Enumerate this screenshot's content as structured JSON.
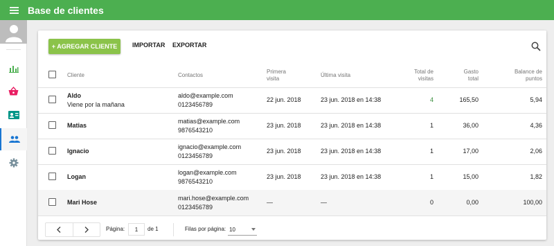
{
  "header": {
    "title": "Base de clientes",
    "menu_icon": "menu-icon"
  },
  "sidebar": {
    "avatar_icon": "user-avatar-icon",
    "items": [
      {
        "icon": "bar-chart-icon",
        "color": "#4caf50"
      },
      {
        "icon": "basket-icon",
        "color": "#e91e63"
      },
      {
        "icon": "contact-card-icon",
        "color": "#009688"
      },
      {
        "icon": "people-icon",
        "color": "#1976d2",
        "active": true
      },
      {
        "icon": "settings-icon",
        "color": "#78909c"
      }
    ]
  },
  "toolbar": {
    "add_label": "+ AGREGAR CLIENTE",
    "import_label": "IMPORTAR",
    "export_label": "EXPORTAR",
    "search_icon": "search-icon"
  },
  "table": {
    "headers": {
      "client": "Cliente",
      "contacts": "Contactos",
      "first_visit_1": "Primera",
      "first_visit_2": "visita",
      "last_visit": "Última visita",
      "total_visits_1": "Total de",
      "total_visits_2": "visitas",
      "spend_1": "Gasto",
      "spend_2": "total",
      "points_1": "Balance de",
      "points_2": "puntos"
    },
    "rows": [
      {
        "name": "Aldo",
        "note": "Viene por la mañana",
        "email": "aldo@example.com",
        "phone": "0123456789",
        "first_visit": "22 jun. 2018",
        "last_visit": "23 jun. 2018 en 14:38",
        "visits": "4",
        "spend": "165,50",
        "points": "5,94"
      },
      {
        "name": "Matias",
        "note": "",
        "email": "matias@example.com",
        "phone": "9876543210",
        "first_visit": "23 jun. 2018",
        "last_visit": "23 jun. 2018 en 14:38",
        "visits": "1",
        "spend": "36,00",
        "points": "4,36"
      },
      {
        "name": "Ignacio",
        "note": "",
        "email": "ignacio@example.com",
        "phone": "0123456789",
        "first_visit": "23 jun. 2018",
        "last_visit": "23 jun. 2018 en 14:38",
        "visits": "1",
        "spend": "17,00",
        "points": "2,06"
      },
      {
        "name": "Logan",
        "note": "",
        "email": "logan@example.com",
        "phone": "9876543210",
        "first_visit": "23 jun. 2018",
        "last_visit": "23 jun. 2018 en 14:38",
        "visits": "1",
        "spend": "15,00",
        "points": "1,82"
      },
      {
        "name": "Mari Hose",
        "note": "",
        "email": "mari.hose@example.com",
        "phone": "0123456789",
        "first_visit": "—",
        "last_visit": "—",
        "visits": "0",
        "spend": "0,00",
        "points": "100,00"
      }
    ]
  },
  "pagination": {
    "page_label": "Página:",
    "page_value": "1",
    "of_label": "de 1",
    "rows_label": "Filas por página:",
    "rows_value": "10",
    "prev_icon": "chevron-left-icon",
    "next_icon": "chevron-right-icon",
    "dropdown_icon": "dropdown-arrow-icon"
  },
  "colors": {
    "appbar": "#4caf50",
    "add_button": "#8bc34a",
    "active_nav": "#1976d2",
    "visits_highlight": "#388e3c"
  }
}
